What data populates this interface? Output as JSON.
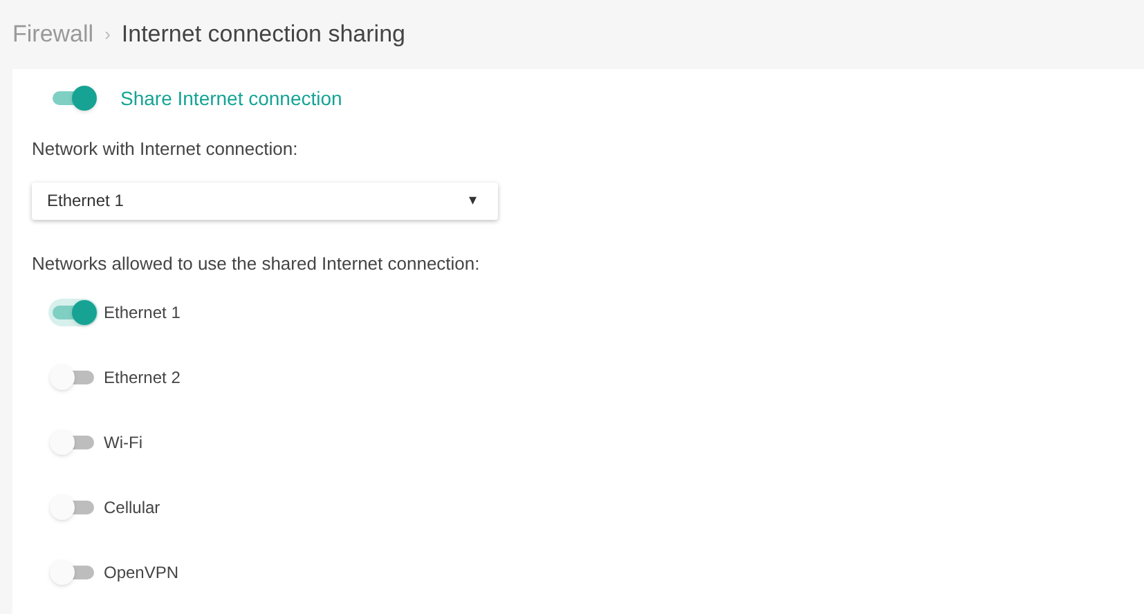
{
  "breadcrumb": {
    "parent": "Firewall",
    "separator": "›",
    "current": "Internet connection sharing"
  },
  "share_toggle": {
    "label": "Share Internet connection",
    "on": true
  },
  "network_select": {
    "label": "Network with Internet connection:",
    "value": "Ethernet 1",
    "caret": "▾"
  },
  "allowed_networks": {
    "label": "Networks allowed to use the shared Internet connection:",
    "items": [
      {
        "label": "Ethernet 1",
        "on": true,
        "focused": true
      },
      {
        "label": "Ethernet 2",
        "on": false,
        "focused": false
      },
      {
        "label": "Wi-Fi",
        "on": false,
        "focused": false
      },
      {
        "label": "Cellular",
        "on": false,
        "focused": false
      },
      {
        "label": "OpenVPN",
        "on": false,
        "focused": false
      }
    ]
  }
}
